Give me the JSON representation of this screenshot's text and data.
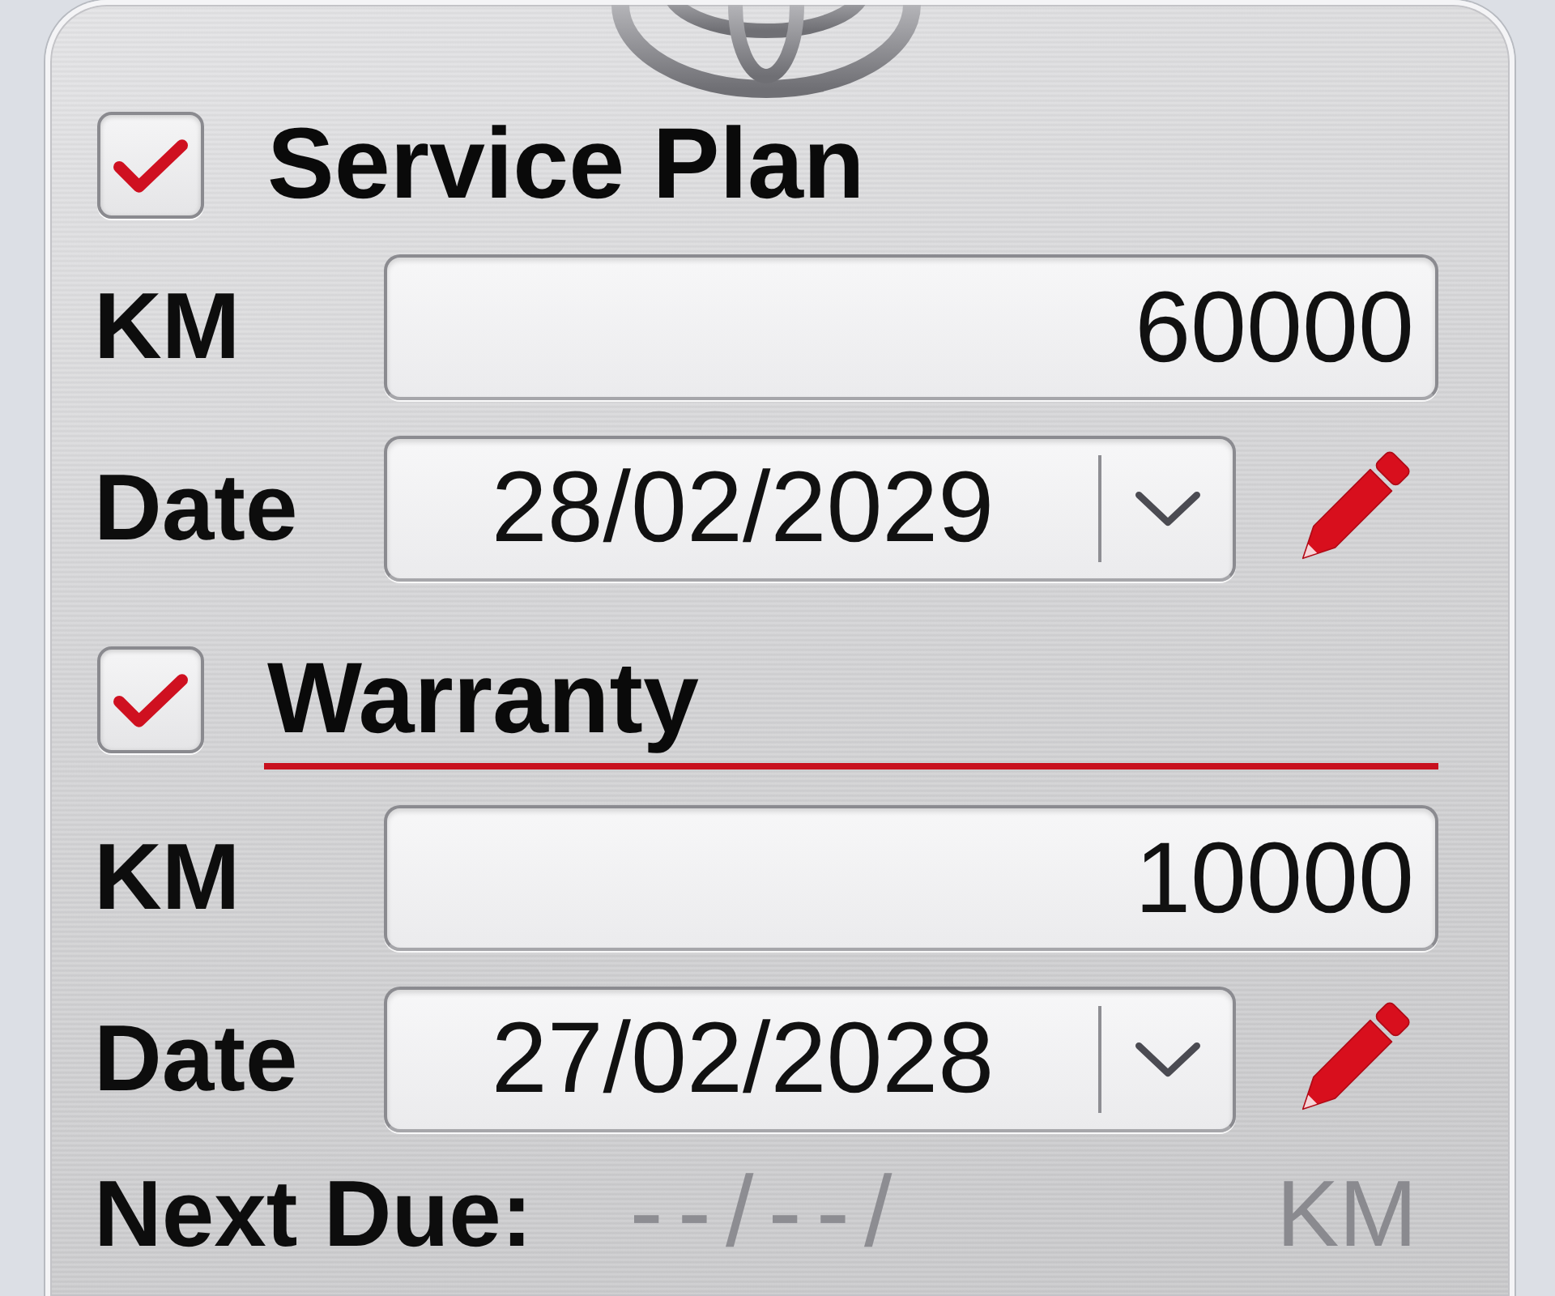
{
  "sections": [
    {
      "title": "Service Plan",
      "checked": true,
      "selected": false,
      "km": {
        "label": "KM",
        "value": "60000"
      },
      "date": {
        "label": "Date",
        "value": "28/02/2029"
      }
    },
    {
      "title": "Warranty",
      "checked": true,
      "selected": true,
      "km": {
        "label": "KM",
        "value": "10000"
      },
      "date": {
        "label": "Date",
        "value": "27/02/2028"
      }
    }
  ],
  "next_due": {
    "label": "Next Due:",
    "date": "--/--/",
    "unit": "KM"
  }
}
